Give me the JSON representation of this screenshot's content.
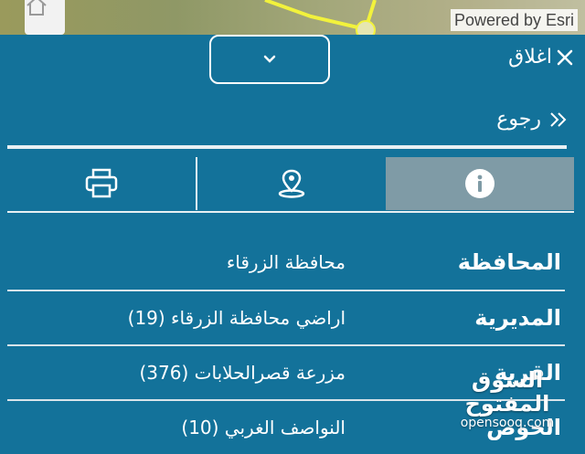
{
  "map": {
    "attribution": "Powered by Esri"
  },
  "panel": {
    "close_label": "اغلاق",
    "back_label": "رجوع",
    "tabs": [
      {
        "icon": "info-icon",
        "active": true
      },
      {
        "icon": "location-pin-icon",
        "active": false
      },
      {
        "icon": "printer-icon",
        "active": false
      }
    ]
  },
  "details": [
    {
      "label": "المحافظة",
      "value": "محافظة الزرقاء"
    },
    {
      "label": "المديرية",
      "value": "اراضي محافظة الزرقاء (19)"
    },
    {
      "label": "القرية",
      "value": "مزرعة قصرالحلابات (376)"
    },
    {
      "label": "الحوض",
      "value": "النواصف الغربي (10)"
    }
  ],
  "watermark": {
    "line1": "السوق المفتوح",
    "line2": "opensooq.com"
  },
  "colors": {
    "panel_bg": "#13729a",
    "active_tab": "#7f9ba6",
    "text": "#ffffff"
  }
}
